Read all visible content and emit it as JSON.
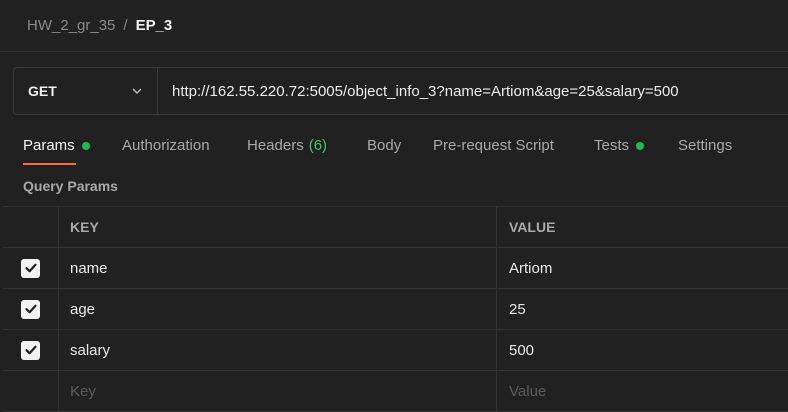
{
  "breadcrumb": {
    "collection": "HW_2_gr_35",
    "separator": "/",
    "request": "EP_3"
  },
  "request": {
    "method": "GET",
    "url": "http://162.55.220.72:5005/object_info_3?name=Artiom&age=25&salary=500"
  },
  "tabs": [
    {
      "label": "Params",
      "active": true,
      "dot": true
    },
    {
      "label": "Authorization"
    },
    {
      "label": "Headers",
      "count": "(6)"
    },
    {
      "label": "Body"
    },
    {
      "label": "Pre-request Script"
    },
    {
      "label": "Tests",
      "dot": true
    },
    {
      "label": "Settings"
    }
  ],
  "query_params": {
    "title": "Query Params",
    "columns": {
      "key": "KEY",
      "value": "VALUE"
    },
    "rows": [
      {
        "checked": true,
        "key": "name",
        "value": "Artiom"
      },
      {
        "checked": true,
        "key": "age",
        "value": "25"
      },
      {
        "checked": true,
        "key": "salary",
        "value": "500"
      }
    ],
    "placeholder": {
      "key": "Key",
      "value": "Value"
    }
  },
  "colors": {
    "background": "#212121",
    "accent": "#ff6c37",
    "status_dot": "#1db954",
    "count": "#49c06f"
  }
}
